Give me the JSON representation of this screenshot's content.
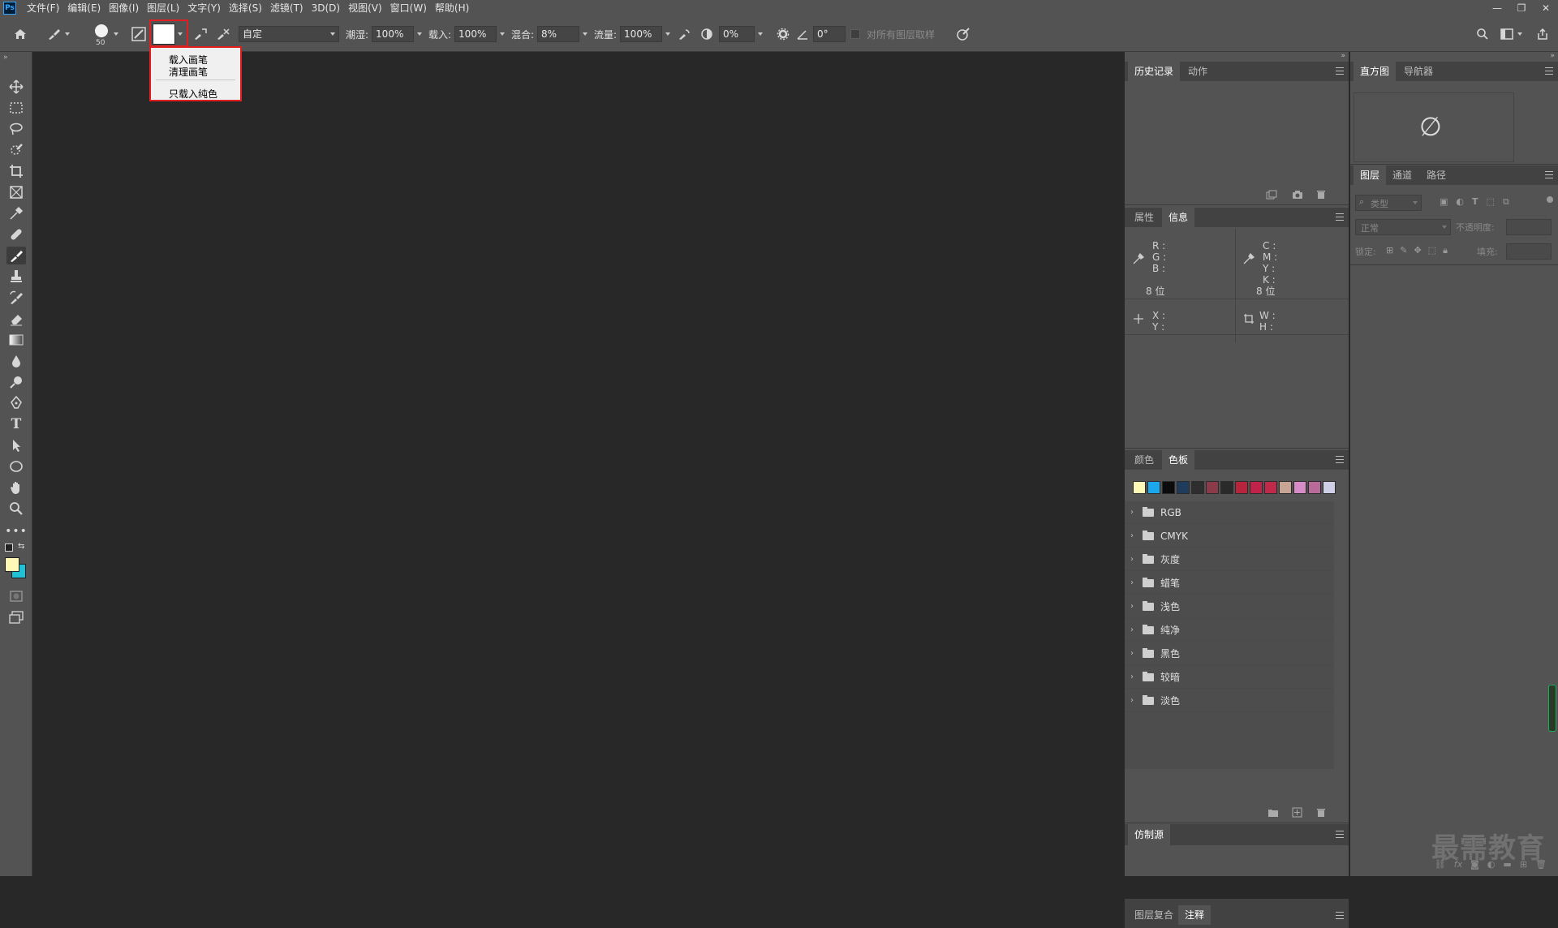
{
  "app": {
    "logo": "Ps"
  },
  "menubar": {
    "items": [
      "文件(F)",
      "编辑(E)",
      "图像(I)",
      "图层(L)",
      "文字(Y)",
      "选择(S)",
      "滤镜(T)",
      "3D(D)",
      "视图(V)",
      "窗口(W)",
      "帮助(H)"
    ]
  },
  "window_controls": {
    "minimize": "—",
    "restore": "❐",
    "close": "✕"
  },
  "options": {
    "brush_size": "50",
    "preset": "自定",
    "wet_label": "潮湿:",
    "wet_value": "100%",
    "load_label": "载入:",
    "load_value": "100%",
    "mix_label": "混合:",
    "mix_value": "8%",
    "flow_label": "流量:",
    "flow_value": "100%",
    "smooth_value": "0%",
    "angle_value": "0°",
    "sample_all_label": "对所有图层取样"
  },
  "popup": {
    "items": [
      "载入画笔",
      "清理画笔",
      "只载入纯色"
    ]
  },
  "history_panel": {
    "tabs": [
      "历史记录",
      "动作"
    ]
  },
  "props_panel": {
    "tabs": [
      "属性",
      "信息"
    ],
    "left_rgb": [
      "R :",
      "G :",
      "B :"
    ],
    "left_bits": "8 位",
    "right_cmyk": [
      "C :",
      "M :",
      "Y :",
      "K :"
    ],
    "right_bits": "8 位",
    "xy": [
      "X :",
      "Y :"
    ],
    "wh": [
      "W :",
      "H :"
    ]
  },
  "swatch_panel": {
    "tabs": [
      "颜色",
      "色板"
    ],
    "colors": [
      "#fff9b8",
      "#1aa7ec",
      "#0b0b0b",
      "#1f3c5c",
      "#2e2e2e",
      "#8b3a4a",
      "#2a2a2a",
      "#b8243c",
      "#c1224a",
      "#bf2a4a",
      "#c7a595",
      "#d88cc7",
      "#b86b98",
      "#cfcfe8"
    ],
    "groups": [
      "RGB",
      "CMYK",
      "灰度",
      "蜡笔",
      "浅色",
      "纯净",
      "黑色",
      "较暗",
      "淡色"
    ]
  },
  "clone_panel": {
    "title": "仿制源"
  },
  "bottom_tabs": {
    "tabs": [
      "图层复合",
      "注释"
    ]
  },
  "histogram_panel": {
    "tabs": [
      "直方图",
      "导航器"
    ],
    "empty_symbol": "∅"
  },
  "layers_panel": {
    "tabs": [
      "图层",
      "通道",
      "路径"
    ],
    "filter_placeholder": "类型",
    "blend_mode": "正常",
    "opacity_label": "不透明度:",
    "lock_label": "锁定:",
    "fill_label": "填充:"
  },
  "watermark": "最需教育"
}
